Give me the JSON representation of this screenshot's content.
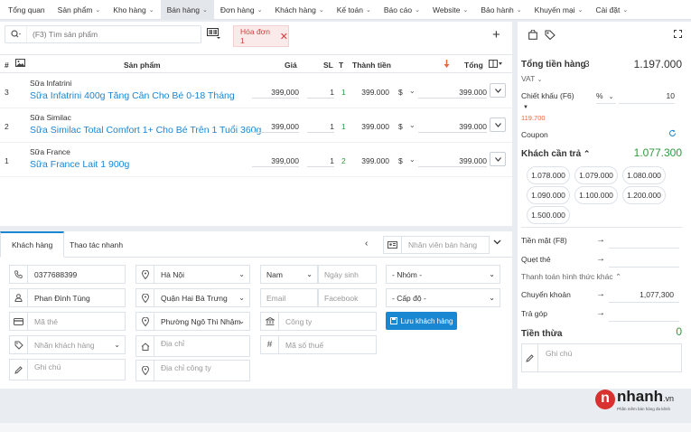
{
  "nav": {
    "items": [
      {
        "label": "Tổng quan",
        "chev": false,
        "active": false
      },
      {
        "label": "Sản phẩm",
        "chev": true,
        "active": false
      },
      {
        "label": "Kho hàng",
        "chev": true,
        "active": false
      },
      {
        "label": "Bán hàng",
        "chev": true,
        "active": true
      },
      {
        "label": "Đơn hàng",
        "chev": true,
        "active": false
      },
      {
        "label": "Khách hàng",
        "chev": true,
        "active": false
      },
      {
        "label": "Kế toán",
        "chev": true,
        "active": false
      },
      {
        "label": "Báo cáo",
        "chev": true,
        "active": false
      },
      {
        "label": "Website",
        "chev": true,
        "active": false
      },
      {
        "label": "Bảo hành",
        "chev": true,
        "active": false
      },
      {
        "label": "Khuyến mại",
        "chev": true,
        "active": false
      },
      {
        "label": "Cài đặt",
        "chev": true,
        "active": false
      }
    ]
  },
  "search": {
    "placeholder": "(F3) Tìm sản phẩm"
  },
  "invoice_tab": {
    "label": "Hóa đơn 1",
    "close": "✕"
  },
  "add_tab": "+",
  "table": {
    "headers": {
      "no": "#",
      "product": "Sản phẩm",
      "price": "Giá",
      "qty": "SL",
      "t": "T",
      "amount": "Thành tiền",
      "total": "Tổng"
    },
    "rows": [
      {
        "no": "3",
        "category": "Sữa Infatrini",
        "name": "Sữa Infatrini 400g Tăng Cân Cho Bé 0-18 Tháng",
        "price": "399,000",
        "qty": "1",
        "t": "1",
        "amount": "399.000",
        "currency": "$",
        "total": "399.000"
      },
      {
        "no": "2",
        "category": "Sữa Similac",
        "name": "Sữa Similac Total Comfort 1+ Cho Bé Trên 1 Tuổi 360g",
        "price": "399,000",
        "qty": "1",
        "t": "1",
        "amount": "399.000",
        "currency": "$",
        "total": "399.000"
      },
      {
        "no": "1",
        "category": "Sữa France",
        "name": "Sữa France Lait 1 900g",
        "price": "399,000",
        "qty": "1",
        "t": "2",
        "amount": "399.000",
        "currency": "$",
        "total": "399.000"
      }
    ]
  },
  "customer": {
    "tabs": [
      "Khách hàng",
      "Thao tác nhanh"
    ],
    "staff_placeholder": "Nhân viên bán hàng",
    "phone": "0377688399",
    "name": "Phan Đình Tùng",
    "card_placeholder": "Mã thẻ",
    "tag_placeholder": "Nhãn khách hàng",
    "note_placeholder": "Ghi chú",
    "city": "Hà Nội",
    "district": "Quận Hai Bà Trưng",
    "ward": "Phường Ngô Thì Nhậm",
    "address_placeholder": "Địa chỉ",
    "company_address_placeholder": "Địa chỉ công ty",
    "gender": "Nam",
    "birthday_placeholder": "Ngày sinh",
    "email_placeholder": "Email",
    "facebook_placeholder": "Facebook",
    "company_placeholder": "Công ty",
    "tax_placeholder": "Mã số thuế",
    "group": "- Nhóm -",
    "level": "- Cấp độ -",
    "save_button": "Lưu khách hàng"
  },
  "summary": {
    "total_label": "Tổng tiền hàng",
    "total_count": "3",
    "total_value": "1.197.000",
    "vat_label": "VAT",
    "discount_label": "Chiết khấu (F6)",
    "discount_unit": "%",
    "discount_value": "10",
    "discount_amount": "119.700",
    "coupon_label": "Coupon",
    "customer_pay_label": "Khách cần trả",
    "customer_pay_value": "1.077.300",
    "quick_amounts": [
      "1.078.000",
      "1.079.000",
      "1.080.000",
      "1.090.000",
      "1.100.000",
      "1.200.000",
      "1.500.000"
    ],
    "cash_label": "Tiền mặt (F8)",
    "card_label": "Quẹt thẻ",
    "other_methods_label": "Thanh toán hình thức khác",
    "transfer_label": "Chuyển khoản",
    "transfer_value": "1,077,300",
    "installment_label": "Trả góp",
    "change_label": "Tiền thừa",
    "change_value": "0",
    "note_placeholder": "Ghi chú"
  },
  "brand": {
    "name_red": "n",
    "name_dark": "nhanh",
    "suffix": ".vn",
    "tagline": "Phần mềm bán hàng đa kênh"
  },
  "colors": {
    "accent": "#1a87d3",
    "green": "#2e9a3c",
    "red": "#d63b3b"
  }
}
